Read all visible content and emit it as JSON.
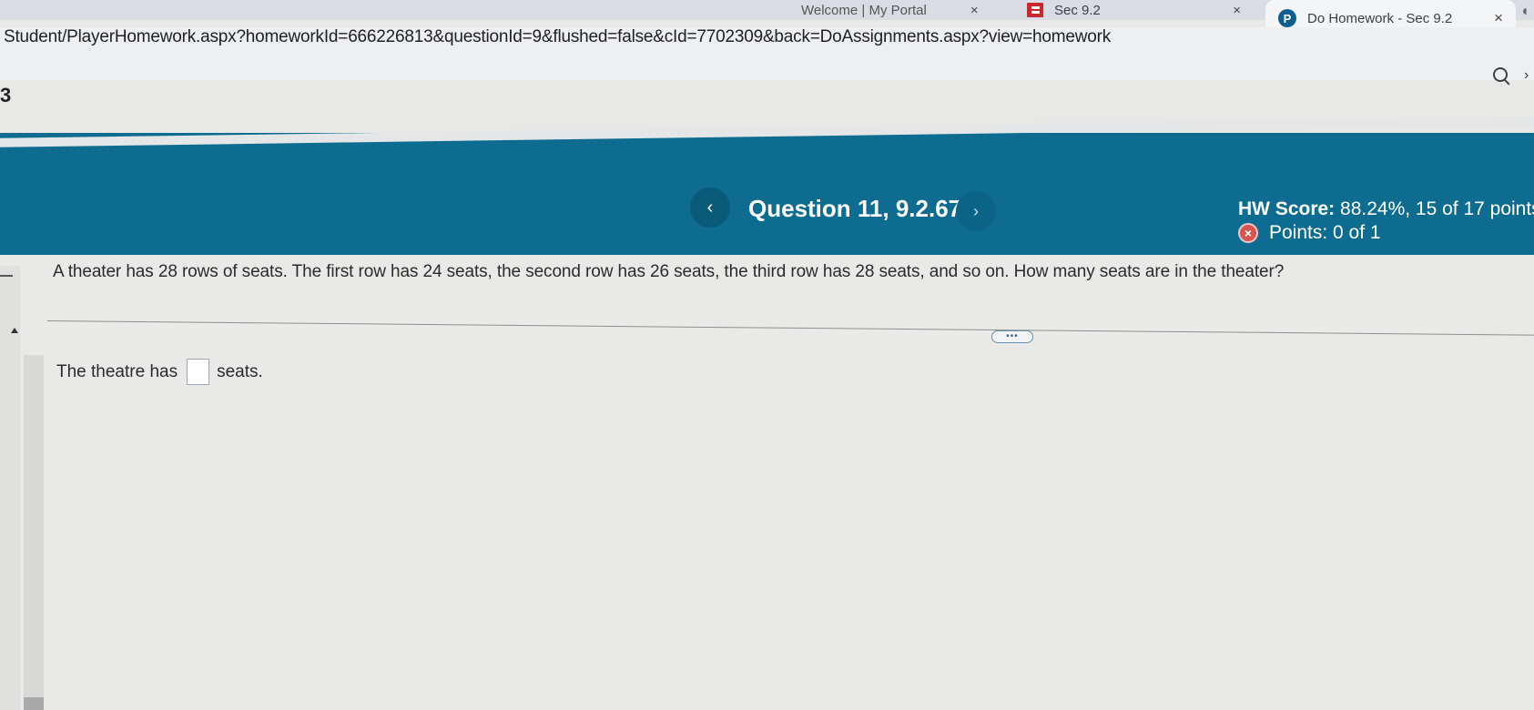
{
  "browser": {
    "tabs": [
      {
        "label": "Welcome | My Portal",
        "close": "×"
      },
      {
        "label": "Sec 9.2",
        "close": "×"
      },
      {
        "label": "Do Homework - Sec 9.2",
        "close": "×",
        "favicon": "P",
        "active": true
      }
    ],
    "url": "Student/PlayerHomework.aspx?homeworkId=666226813&questionId=9&flushed=false&cId=7702309&back=DoAssignments.aspx?view=homework"
  },
  "page": {
    "left_number": "3"
  },
  "header": {
    "prev_glyph": "‹",
    "question_title": "Question 11, 9.2.67",
    "next_glyph": "›",
    "hw_score_label": "HW Score:",
    "hw_score_value": " 88.24%, 15 of 17 points",
    "points_label": "Points: 0 of 1",
    "status_glyph": "×",
    "colors": {
      "band": "#0e6c91",
      "status_incorrect": "#d9534f"
    }
  },
  "question": {
    "text": "A theater has 28 rows of seats. The first row has 24 seats, the second row has 26 seats, the third row has 28 seats, and so on. How many seats are in the theater?",
    "expand_label": "•••",
    "answer_prefix": "The theatre has",
    "answer_value": "",
    "answer_suffix": "seats."
  }
}
